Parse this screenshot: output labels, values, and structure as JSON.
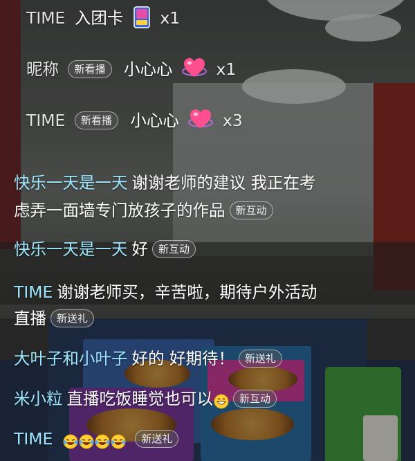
{
  "system_rows": [
    {
      "name": "TIME",
      "text": "入团卡",
      "gift_icon": "member-card-icon",
      "count": "x1"
    },
    {
      "name": "昵称",
      "badge": "新看播",
      "gift": "小心心",
      "gift_icon": "heart-icon",
      "count": "x1"
    },
    {
      "name": "TIME",
      "badge": "新看播",
      "gift": "小心心",
      "gift_icon": "heart-icon",
      "count": "x3"
    }
  ],
  "comments": [
    {
      "user": "快乐一天是一天",
      "text_line1": "谢谢老师的建议 我正在考",
      "text_line2": "虑弄一面墙专门放孩子的作品",
      "badge": "新互动"
    },
    {
      "user": "快乐一天是一天",
      "text": "好",
      "badge": "新互动"
    },
    {
      "user": "TIME",
      "text_line1": "谢谢老师买，辛苦啦，期待户外活动",
      "text_line2": "直播",
      "badge": "新送礼"
    },
    {
      "user": "大叶子和小叶子",
      "text": "好的 好期待！",
      "badge": "新送礼"
    },
    {
      "user": "米小粒",
      "text": "直播吃饭睡觉也可以",
      "emoji": "grin-emoji",
      "badge": "新互动"
    },
    {
      "user": "TIME",
      "emoji": "laughing-tears-emoji",
      "emoji_count": 4,
      "badge": "新送礼"
    }
  ],
  "colors": {
    "username": "#9ee7ff",
    "system_text": "#e2e2e2",
    "message": "#ffffff",
    "badge_border": "rgba(255,255,255,0.55)"
  }
}
